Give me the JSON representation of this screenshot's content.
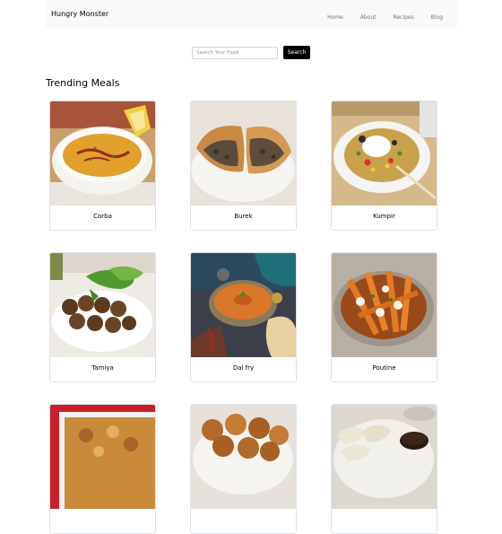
{
  "navbar": {
    "brand": "Hungry Monster",
    "links": [
      {
        "label": "Home"
      },
      {
        "label": "About"
      },
      {
        "label": "Recipes"
      },
      {
        "label": "Blog"
      }
    ]
  },
  "search": {
    "placeholder": "Search Your Food",
    "value": "",
    "button_label": "Search"
  },
  "section": {
    "title": "Trending Meals"
  },
  "meals": [
    {
      "name": "Corba"
    },
    {
      "name": "Burek"
    },
    {
      "name": "Kumpir"
    },
    {
      "name": "Tamiya"
    },
    {
      "name": "Dal fry"
    },
    {
      "name": "Poutine"
    },
    {
      "name": ""
    },
    {
      "name": ""
    },
    {
      "name": ""
    }
  ]
}
